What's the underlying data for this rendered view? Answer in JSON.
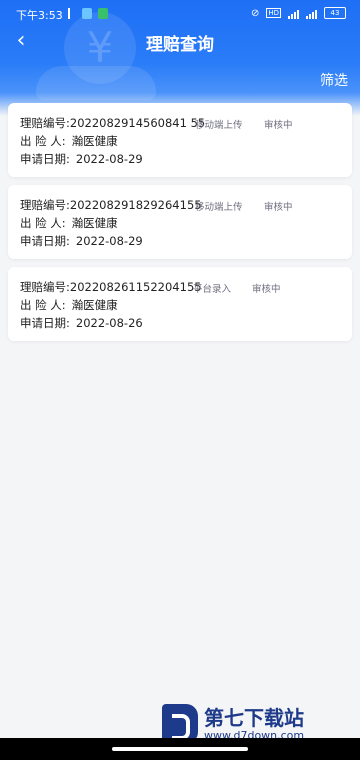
{
  "status_bar": {
    "time": "下午3:53",
    "battery": "43"
  },
  "header": {
    "back_icon": "chevron-left-icon",
    "title": "理赔查询",
    "filter_label": "筛选"
  },
  "claims": [
    {
      "claim_no_label": "理赔编号:",
      "claim_no": "2022082914560841 55",
      "source": "移动端上传",
      "status": "审核中",
      "insurer_label": "出 险 人:",
      "insurer": "瀚医健康",
      "date_label": "申请日期:",
      "date": "2022-08-29"
    },
    {
      "claim_no_label": "理赔编号:",
      "claim_no": "202208291829264155",
      "source": "移动端上传",
      "status": "审核中",
      "insurer_label": "出 险 人:",
      "insurer": "瀚医健康",
      "date_label": "申请日期:",
      "date": "2022-08-29"
    },
    {
      "claim_no_label": "理赔编号:",
      "claim_no": "202208261152204155",
      "source": "平台录入",
      "status": "审核中",
      "insurer_label": "出 险 人:",
      "insurer": "瀚医健康",
      "date_label": "申请日期:",
      "date": "2022-08-26"
    }
  ],
  "watermark": {
    "title": "第七下载站",
    "url": "www.d7down.com"
  }
}
